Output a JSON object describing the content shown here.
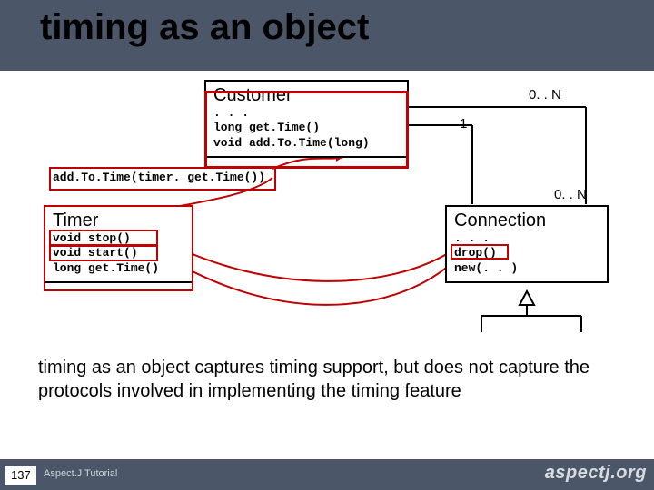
{
  "title": "timing as an object",
  "customer": {
    "name": "Customer",
    "ellipsis": ". . .",
    "m1": "long get.Time()",
    "m2": "void add.To.Time(long)"
  },
  "timer": {
    "name": "Timer",
    "m1": "void stop()",
    "m2": "void start()",
    "m3": "long get.Time()"
  },
  "connection": {
    "name": "Connection",
    "ellipsis": ". . .",
    "m1": "drop()",
    "m2": "new(. . )"
  },
  "addCall": "add.To.Time(timer. get.Time())",
  "mult": {
    "zeroN": "0. . N",
    "one": "1"
  },
  "bodyText": "timing as an object captures timing support, but does not capture the protocols involved in implementing the timing feature",
  "footer": {
    "page": "137",
    "tutorial": "Aspect.J Tutorial",
    "logo": "aspectj.org"
  }
}
